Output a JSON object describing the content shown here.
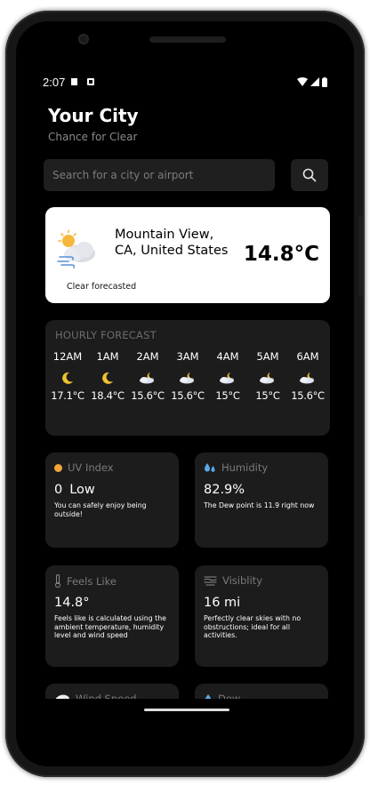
{
  "status_bar": {
    "time": "2:07"
  },
  "header": {
    "title": "Your City",
    "subtitle": "Chance for Clear"
  },
  "search": {
    "placeholder": "Search for a city or airport"
  },
  "current": {
    "location": "Mountain View, CA, United States",
    "temperature": "14.8°C",
    "note": "Clear forecasted",
    "icon": "partly-cloudy-windy-icon"
  },
  "hourly": {
    "title": "HOURLY FORECAST",
    "items": [
      {
        "hour": "12AM",
        "icon": "moon-icon",
        "temp": "17.1°C"
      },
      {
        "hour": "1AM",
        "icon": "moon-icon",
        "temp": "18.4°C"
      },
      {
        "hour": "2AM",
        "icon": "cloud-moon-icon",
        "temp": "15.6°C"
      },
      {
        "hour": "3AM",
        "icon": "cloud-moon-icon",
        "temp": "15.6°C"
      },
      {
        "hour": "4AM",
        "icon": "cloud-moon-icon",
        "temp": "15°C"
      },
      {
        "hour": "5AM",
        "icon": "cloud-moon-icon",
        "temp": "15°C"
      },
      {
        "hour": "6AM",
        "icon": "cloud-moon-icon",
        "temp": "15.6°C"
      }
    ]
  },
  "tiles": {
    "uv": {
      "label": "UV Index",
      "value": "0",
      "level": "Low",
      "description": "You can safely enjoy being outside!"
    },
    "humidity": {
      "label": "Humidity",
      "value": "82.9%",
      "description": "The Dew point is 11.9 right now"
    },
    "feels_like": {
      "label": "Feels Like",
      "value": "14.8°",
      "description": "Feels like is calculated using the ambient temperature, humidity level and wind speed"
    },
    "visibility": {
      "label": "Visiblity",
      "value": "16 mi",
      "description": "Perfectly clear skies with no obstructions; ideal for all activities."
    },
    "wind": {
      "label": "Wind Speed"
    },
    "dew": {
      "label": "Dew"
    }
  },
  "colors": {
    "accent_uv": "#f2a33a",
    "humidity_blue": "#5aa9e6",
    "moon_yellow": "#f1c232",
    "card_bg": "#1c1c1c"
  }
}
